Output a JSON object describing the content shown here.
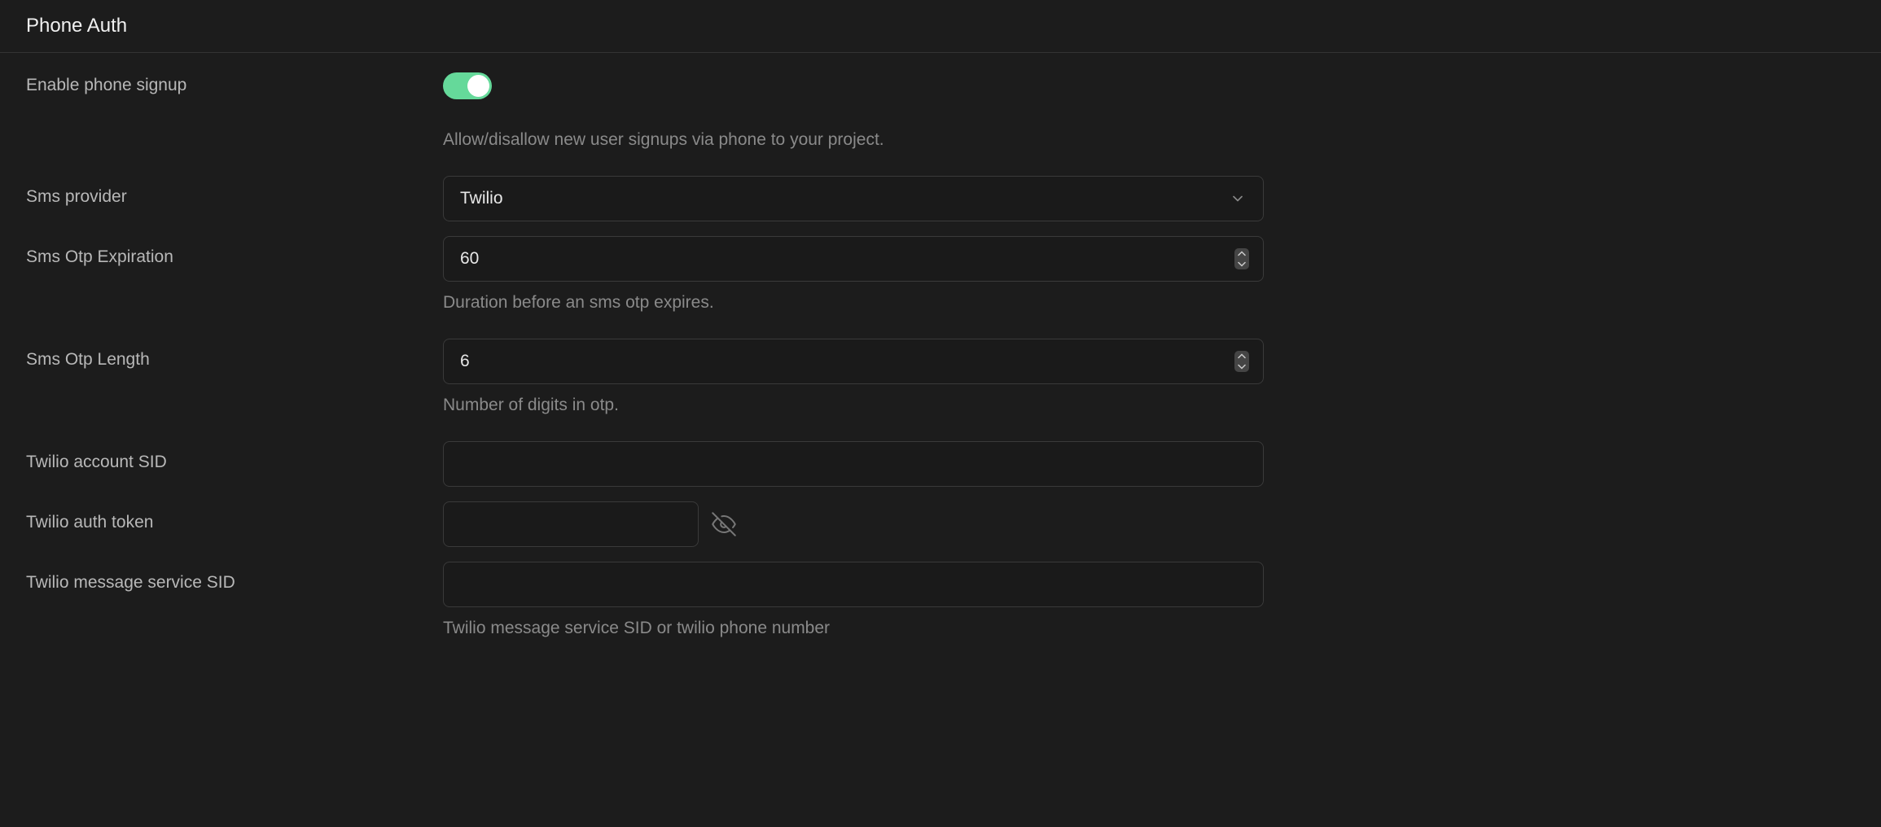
{
  "header": {
    "title": "Phone Auth"
  },
  "fields": {
    "enable_signup": {
      "label": "Enable phone signup",
      "enabled": true,
      "help": "Allow/disallow new user signups via phone to your project."
    },
    "sms_provider": {
      "label": "Sms provider",
      "selected": "Twilio"
    },
    "otp_expiration": {
      "label": "Sms Otp Expiration",
      "value": "60",
      "help": "Duration before an sms otp expires."
    },
    "otp_length": {
      "label": "Sms Otp Length",
      "value": "6",
      "help": "Number of digits in otp."
    },
    "twilio_account_sid": {
      "label": "Twilio account SID",
      "value": ""
    },
    "twilio_auth_token": {
      "label": "Twilio auth token",
      "value": ""
    },
    "twilio_message_sid": {
      "label": "Twilio message service SID",
      "value": "",
      "help": "Twilio message service SID or twilio phone number"
    }
  }
}
